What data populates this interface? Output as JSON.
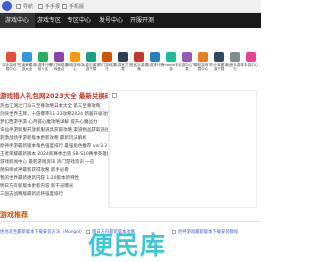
{
  "topbar": {
    "items": [
      "导航",
      "手手报",
      "手机版"
    ]
  },
  "nav": {
    "items": [
      "游戏中心",
      "游戏专区",
      "专区中心",
      "发号中心",
      "开服开测"
    ]
  },
  "apps": [
    {
      "name": "手手游戏下载中心",
      "color": "#e74c3c"
    },
    {
      "name": "王者荣耀手游大全",
      "color": "#3498db"
    },
    {
      "name": "手游排行榜前十名",
      "color": "#27ae60"
    },
    {
      "name": "热门网络游戏盘点",
      "color": "#8e44ad"
    },
    {
      "name": "网络游戏中心",
      "color": "#f39c12"
    },
    {
      "name": "火影忍者手游下载",
      "color": "#16a085"
    },
    {
      "name": "热门游戏排行",
      "color": "#d35400"
    },
    {
      "name": "手游官方下载",
      "color": "#2c3e50"
    },
    {
      "name": "全民手游攻略",
      "color": "#c0392b"
    },
    {
      "name": "手游排行榜",
      "color": "#2980b9"
    },
    {
      "name": "mobile手游",
      "color": "#1abc9c"
    },
    {
      "name": "手游中心下载",
      "color": "#9b59b6"
    },
    {
      "name": "单机游戏下载中心",
      "color": "#e67e22"
    },
    {
      "name": "小小军团手游下载",
      "color": "#34495e"
    },
    {
      "name": "仙侠手游排行",
      "color": "#7f8c8d"
    },
    {
      "name": "手游中心",
      "color": "#e84393"
    }
  ],
  "headline": "游戏猎人礼包网2023大全 最新兑换码分享",
  "news": [
    "热血江湖之门派三至尊攻略日本大全 第三至尊攻略",
    "剑侠世界王牌，十倍爆率11-23攻略2024 新服升级攻略",
    "梦幻西游手游 心月狐心魔攻略详解 提升心魔战力",
    "诛仙手游新服开放新服道具获取攻略 渠道物品获取途径",
    "刺激战场手游新版本更新攻略 最新玩法解析",
    "原神手游最新版本角色强度排行 最强角色推荐 ver3.2",
    "王者荣耀最新版本 2024新赛季出装 S8-S10赛季英雄推荐",
    "游戏新闻中心 最新游戏资讯 热门游戏资讯 一览",
    "阴阳师式神最新获得攻略 新手必看",
    "我的世界最新更新内容 1.20版本新特性",
    "明日方舟新版本更新内容 新干员曝光",
    "三国志战略版最新武将强度排行"
  ],
  "section_title": "游戏推荐",
  "recommend": [
    "绝地求生最新版本下载安装方法（Mongol）",
    "明日方舟最新版本攻略",
    "原神游戏最新版本下载安装教程"
  ],
  "watermark": "便民库"
}
